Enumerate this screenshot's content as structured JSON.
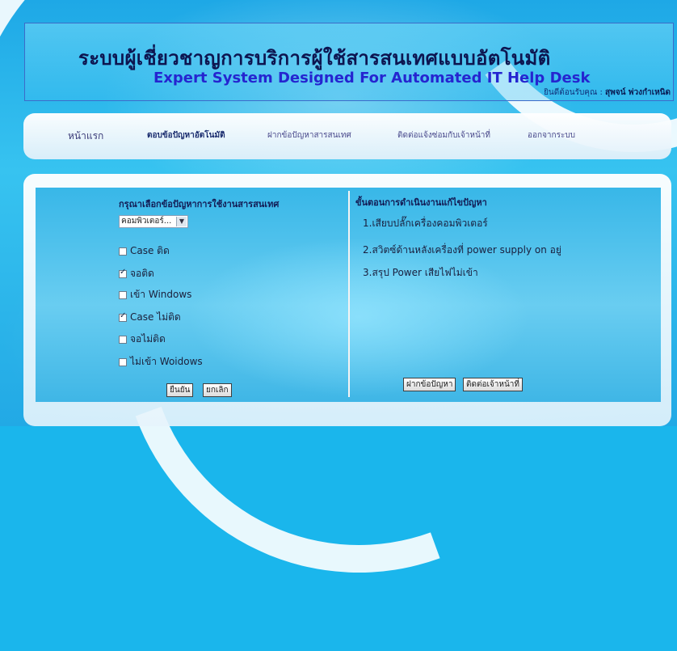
{
  "header": {
    "title_th": "ระบบผู้เชี่ยวชาญการบริการผู้ใช้สารสนเทศแบบอัตโนมัติ",
    "title_en": "Expert System Designed For Automated IT Help Desk",
    "welcome_prefix": "ยินดีต้อนรับคุณ :",
    "user_name": "สุพจน์ พ่วงกำเหนิด"
  },
  "nav": {
    "items": [
      {
        "label": "หน้าแรก"
      },
      {
        "label": "ตอบข้อปัญหาอัตโนมัติ"
      },
      {
        "label": "ฝากข้อปัญหาสารสนเทศ"
      },
      {
        "label": "ติดต่อแจ้งซ่อมกับเจ้าหน้าที่"
      },
      {
        "label": "ออกจากระบบ"
      }
    ]
  },
  "left_panel": {
    "title": "กรุณาเลือกข้อปัญหาการใช้งานสารสนเทศ",
    "select_value": "คอมพิวเตอร์...",
    "checkboxes": [
      {
        "label": "Case ติด",
        "checked": false
      },
      {
        "label": "จอติด",
        "checked": true
      },
      {
        "label": "เข้า Windows",
        "checked": false
      },
      {
        "label": "Case ไม่ติด",
        "checked": true
      },
      {
        "label": "จอไม่ติด",
        "checked": false
      },
      {
        "label": "ไม่เข้า Woidows",
        "checked": false
      }
    ],
    "confirm_label": "ยืนยัน",
    "cancel_label": "ยกเลิก"
  },
  "right_panel": {
    "title": "ขั้นตอนการดำเนินงานแก้ไขปัญหา",
    "steps": [
      "1.เสียบปลั๊กเครื่องคอมพิวเตอร์",
      "2.สวิตซ์ด้านหลังเครื่องที่ power supply on อยู่",
      "3.สรุป Power เสียไฟไม่เข้า"
    ],
    "submit_problem_label": "ฝากข้อปัญหา",
    "contact_staff_label": "ติดต่อเจ้าหน้าที่"
  }
}
